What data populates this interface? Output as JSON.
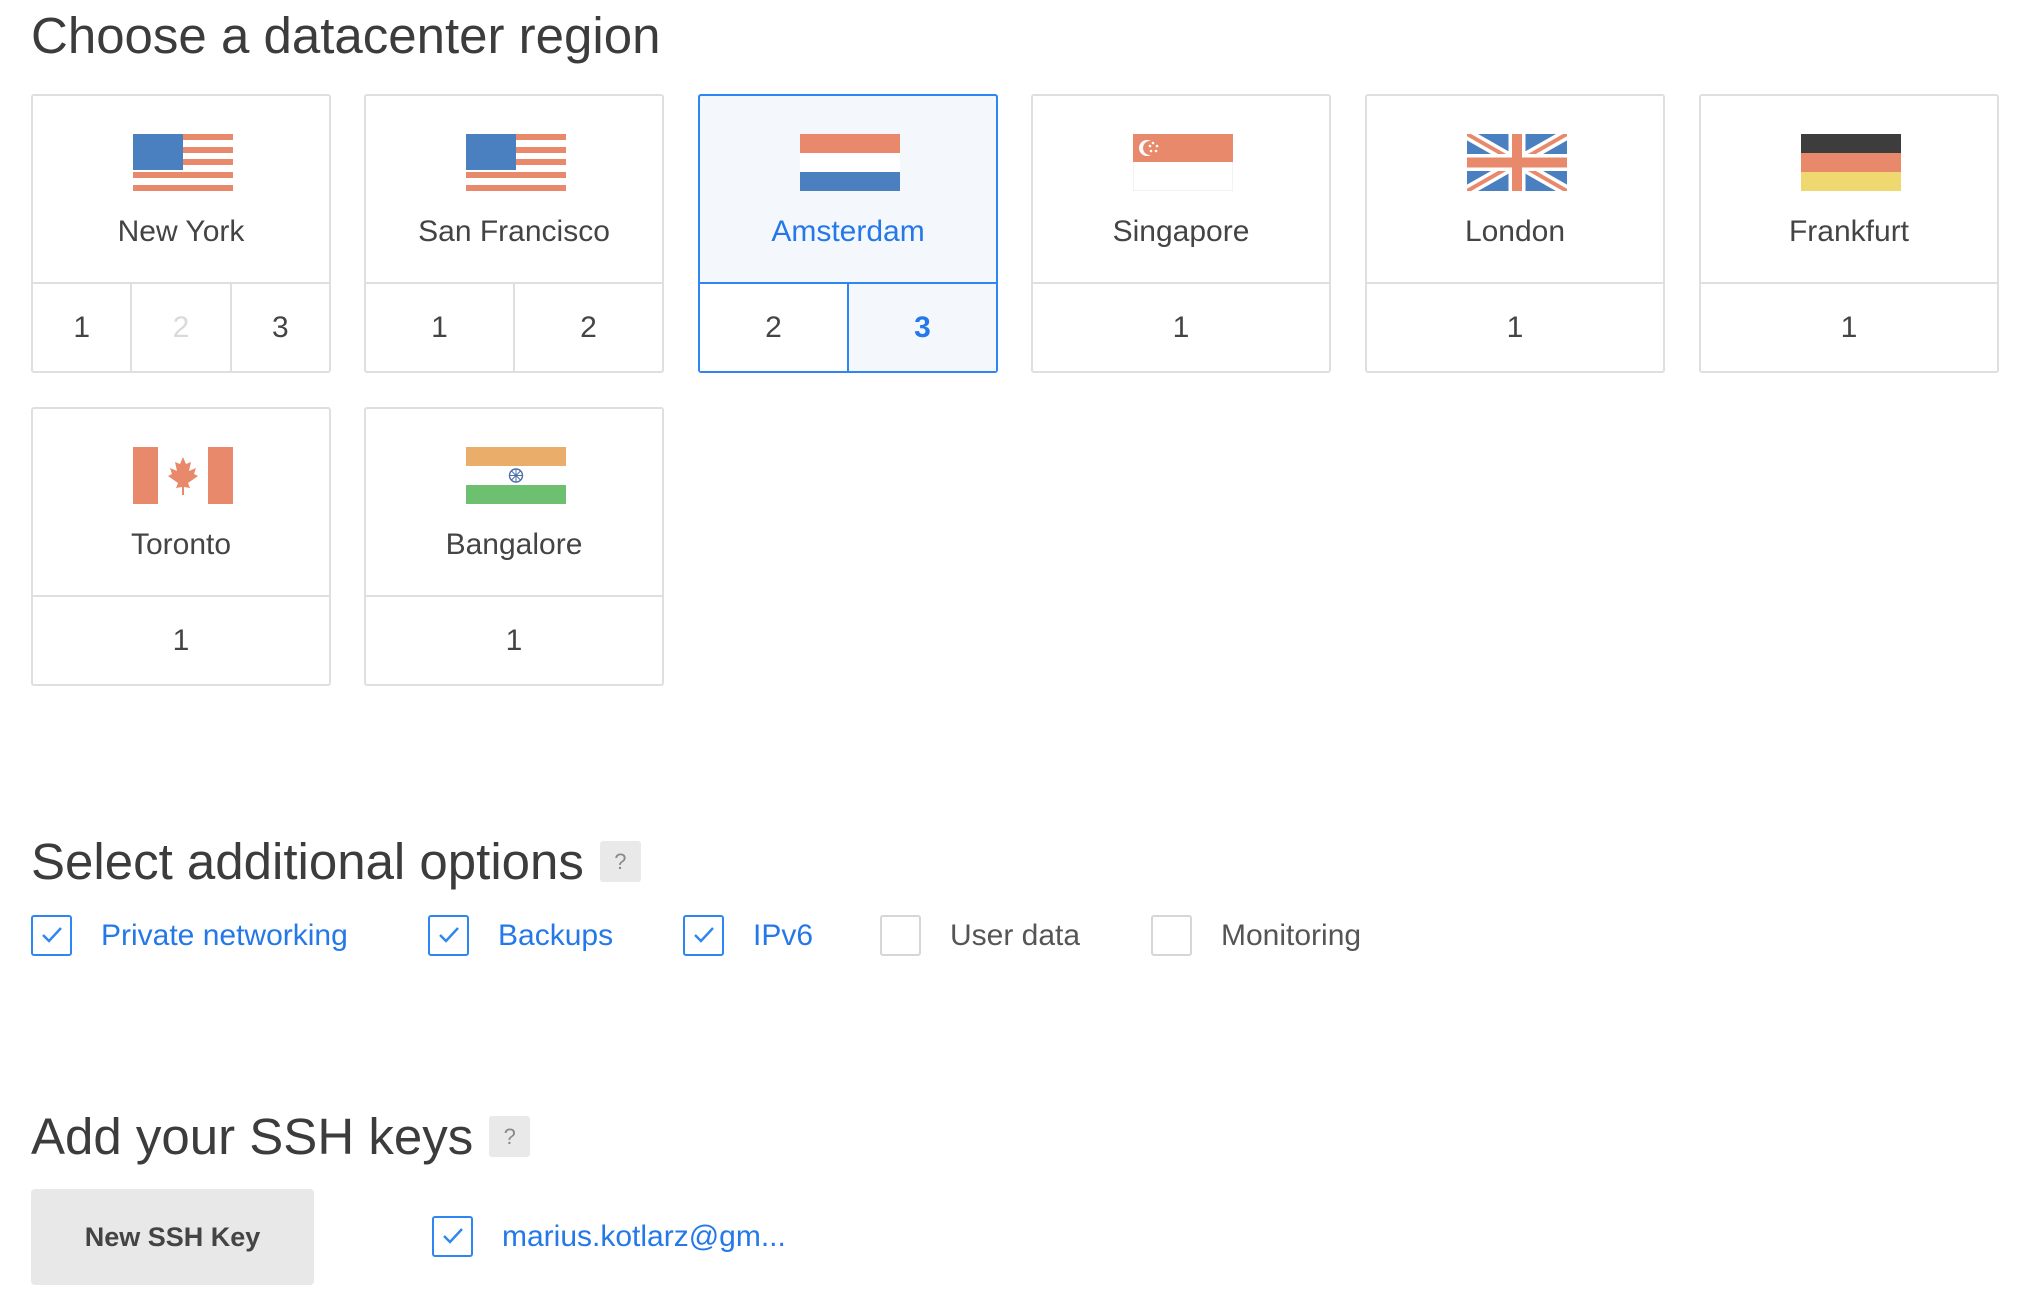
{
  "region_section": {
    "title": "Choose a datacenter region"
  },
  "regions": [
    {
      "name": "New York",
      "flag": "us-flag-icon",
      "datacenters": [
        {
          "label": "1",
          "state": "available"
        },
        {
          "label": "2",
          "state": "disabled"
        },
        {
          "label": "3",
          "state": "available"
        }
      ]
    },
    {
      "name": "San Francisco",
      "flag": "us-flag-icon",
      "datacenters": [
        {
          "label": "1",
          "state": "available"
        },
        {
          "label": "2",
          "state": "available"
        }
      ]
    },
    {
      "name": "Amsterdam",
      "flag": "netherlands-flag-icon",
      "selected": true,
      "datacenters": [
        {
          "label": "2",
          "state": "available"
        },
        {
          "label": "3",
          "state": "selected"
        }
      ]
    },
    {
      "name": "Singapore",
      "flag": "singapore-flag-icon",
      "datacenters": [
        {
          "label": "1",
          "state": "available"
        }
      ]
    },
    {
      "name": "London",
      "flag": "uk-flag-icon",
      "datacenters": [
        {
          "label": "1",
          "state": "available"
        }
      ]
    },
    {
      "name": "Frankfurt",
      "flag": "germany-flag-icon",
      "datacenters": [
        {
          "label": "1",
          "state": "available"
        }
      ]
    },
    {
      "name": "Toronto",
      "flag": "canada-flag-icon",
      "datacenters": [
        {
          "label": "1",
          "state": "available"
        }
      ]
    },
    {
      "name": "Bangalore",
      "flag": "india-flag-icon",
      "datacenters": [
        {
          "label": "1",
          "state": "available"
        }
      ]
    }
  ],
  "options_section": {
    "title": "Select additional options",
    "help": "?",
    "options": [
      {
        "label": "Private networking",
        "checked": true
      },
      {
        "label": "Backups",
        "checked": true
      },
      {
        "label": "IPv6",
        "checked": true
      },
      {
        "label": "User data",
        "checked": false
      },
      {
        "label": "Monitoring",
        "checked": false
      }
    ]
  },
  "ssh_section": {
    "title": "Add your SSH keys",
    "help": "?",
    "new_key_button": "New SSH Key",
    "keys": [
      {
        "label": "marius.kotlarz@gm...",
        "checked": true
      }
    ]
  },
  "colors": {
    "accent": "#2d86f1",
    "accent_text": "#2478e8",
    "border": "#dfdfdf"
  }
}
